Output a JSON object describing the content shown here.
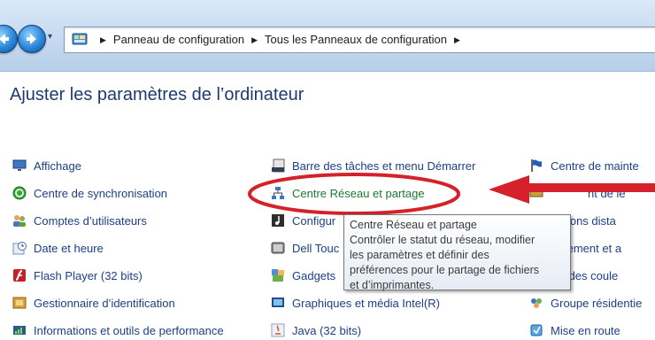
{
  "breadcrumb": {
    "items": [
      "Panneau de configuration",
      "Tous les Panneaux de configuration"
    ],
    "trailing_separator": "▸"
  },
  "page_title": "Ajuster les paramètres de l’ordinateur",
  "columns": {
    "col1": [
      {
        "label": "Affichage",
        "icon": "monitor-icon"
      },
      {
        "label": "Centre de synchronisation",
        "icon": "sync-icon"
      },
      {
        "label": "Comptes d’utilisateurs",
        "icon": "users-icon"
      },
      {
        "label": "Date et heure",
        "icon": "clock-icon"
      },
      {
        "label": "Flash Player (32 bits)",
        "icon": "flash-icon"
      },
      {
        "label": "Gestionnaire d’identification",
        "icon": "vault-icon"
      },
      {
        "label": "Informations et outils de performance",
        "icon": "performance-icon"
      }
    ],
    "col2": [
      {
        "label": "Barre des tâches et menu Démarrer",
        "icon": "taskbar-icon"
      },
      {
        "label": "Centre Réseau et partage",
        "icon": "network-icon"
      },
      {
        "label": "Configur",
        "icon": "sound-icon"
      },
      {
        "label": "Dell Touc",
        "icon": "touchpad-icon"
      },
      {
        "label": "Gadgets",
        "icon": "gadgets-icon"
      },
      {
        "label": "Graphiques et média Intel(R)",
        "icon": "intel-graphics-icon"
      },
      {
        "label": "Java (32 bits)",
        "icon": "java-icon"
      }
    ],
    "col3": [
      {
        "label": "Centre de mainte",
        "icon": "flag-icon"
      },
      {
        "label": "nt de le",
        "icon": "keyboard-icon"
      },
      {
        "label": "nexions dista",
        "icon": "remote-icon"
      },
      {
        "label": "lacement et a",
        "icon": "location-icon"
      },
      {
        "label": "tion des coule",
        "icon": "color-icon"
      },
      {
        "label": "Groupe résidentie",
        "icon": "homegroup-icon"
      },
      {
        "label": "Mise en route",
        "icon": "getting-started-icon"
      }
    ]
  },
  "tooltip": {
    "lines": [
      "Centre Réseau et partage",
      "Contrôler le statut du réseau, modifier",
      "les paramètres et définir des",
      "préférences pour le partage de fichiers",
      "et d’imprimantes."
    ]
  },
  "colors": {
    "link": "#1c3f84",
    "annotation_red": "#d4212a",
    "title": "#1e3b6e"
  }
}
